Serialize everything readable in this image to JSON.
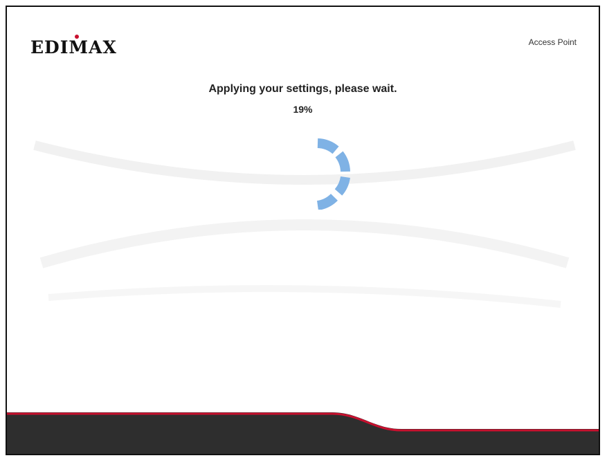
{
  "header": {
    "brand": "EDIMAX",
    "mode_label": "Access Point"
  },
  "main": {
    "status_message": "Applying your settings, please wait.",
    "progress_text": "19%",
    "progress_value": 19
  },
  "icons": {
    "spinner": "loading-spinner-icon"
  },
  "colors": {
    "accent": "#c8102e",
    "spinner": "#7fb2e5",
    "footer_dark": "#2e2e2e"
  }
}
